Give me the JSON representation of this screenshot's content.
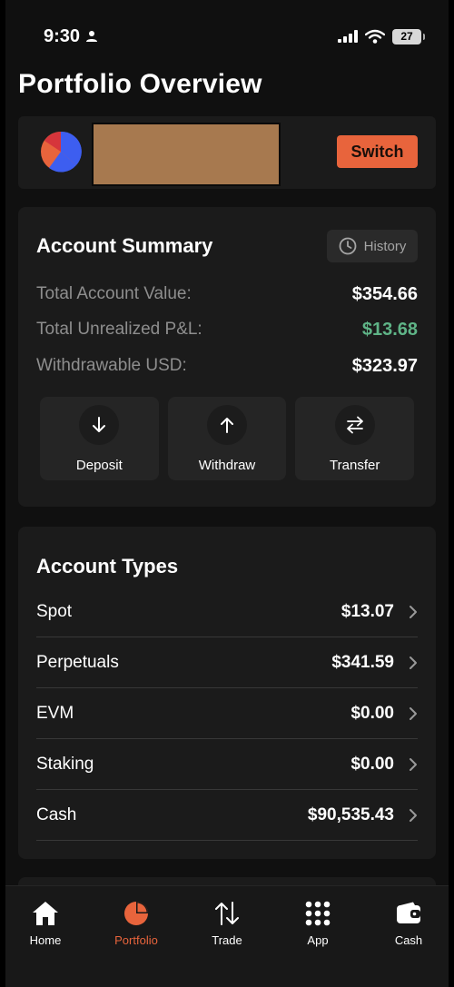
{
  "status_bar": {
    "time": "9:30",
    "battery": "27"
  },
  "page_title": "Portfolio Overview",
  "account_bar": {
    "switch_label": "Switch"
  },
  "summary": {
    "title": "Account Summary",
    "history_label": "History",
    "rows": [
      {
        "label": "Total Account Value:",
        "value": "$354.66"
      },
      {
        "label": "Total Unrealized P&L:",
        "value": "$13.68"
      },
      {
        "label": "Withdrawable USD:",
        "value": "$323.97"
      }
    ],
    "actions": [
      {
        "label": "Deposit",
        "icon": "arrow-down-icon"
      },
      {
        "label": "Withdraw",
        "icon": "arrow-up-icon"
      },
      {
        "label": "Transfer",
        "icon": "transfer-icon"
      }
    ],
    "colors": {
      "positive": "#5fb487"
    }
  },
  "account_types": {
    "title": "Account Types",
    "rows": [
      {
        "name": "Spot",
        "amount": "$13.07"
      },
      {
        "name": "Perpetuals",
        "amount": "$341.59"
      },
      {
        "name": "EVM",
        "amount": "$0.00"
      },
      {
        "name": "Staking",
        "amount": "$0.00"
      },
      {
        "name": "Cash",
        "amount": "$90,535.43"
      }
    ]
  },
  "bottom_nav": {
    "items": [
      {
        "label": "Home",
        "icon": "home-icon",
        "active": false
      },
      {
        "label": "Portfolio",
        "icon": "portfolio-pie-icon",
        "active": true
      },
      {
        "label": "Trade",
        "icon": "trade-arrows-icon",
        "active": false
      },
      {
        "label": "App",
        "icon": "app-grid-icon",
        "active": false
      },
      {
        "label": "Cash",
        "icon": "wallet-icon",
        "active": false
      }
    ]
  },
  "colors": {
    "accent": "#e8643c",
    "background": "#101010",
    "card": "#1b1b1b"
  }
}
